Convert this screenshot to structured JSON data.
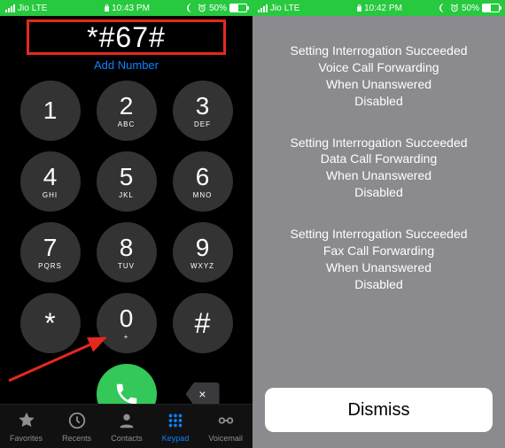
{
  "left": {
    "status": {
      "carrier": "Jio",
      "network": "LTE",
      "time": "10:43 PM",
      "battery_pct": "50%"
    },
    "entered_number": "*#67#",
    "add_number_label": "Add Number",
    "keys": [
      {
        "digit": "1",
        "sub": ""
      },
      {
        "digit": "2",
        "sub": "ABC"
      },
      {
        "digit": "3",
        "sub": "DEF"
      },
      {
        "digit": "4",
        "sub": "GHI"
      },
      {
        "digit": "5",
        "sub": "JKL"
      },
      {
        "digit": "6",
        "sub": "MNO"
      },
      {
        "digit": "7",
        "sub": "PQRS"
      },
      {
        "digit": "8",
        "sub": "TUV"
      },
      {
        "digit": "9",
        "sub": "WXYZ"
      },
      {
        "digit": "*",
        "sub": ""
      },
      {
        "digit": "0",
        "sub": "+"
      },
      {
        "digit": "#",
        "sub": ""
      }
    ],
    "delete_glyph": "×",
    "tabs": [
      {
        "label": "Favorites"
      },
      {
        "label": "Recents"
      },
      {
        "label": "Contacts"
      },
      {
        "label": "Keypad"
      },
      {
        "label": "Voicemail"
      }
    ],
    "active_tab_index": 3
  },
  "right": {
    "status": {
      "carrier": "Jio",
      "network": "LTE",
      "time": "10:42 PM",
      "battery_pct": "50%"
    },
    "blocks": [
      [
        "Setting Interrogation Succeeded",
        "Voice Call Forwarding",
        "When Unanswered",
        "Disabled"
      ],
      [
        "Setting Interrogation Succeeded",
        "Data Call Forwarding",
        "When Unanswered",
        "Disabled"
      ],
      [
        "Setting Interrogation Succeeded",
        "Fax Call Forwarding",
        "When Unanswered",
        "Disabled"
      ]
    ],
    "dismiss_label": "Dismiss"
  }
}
